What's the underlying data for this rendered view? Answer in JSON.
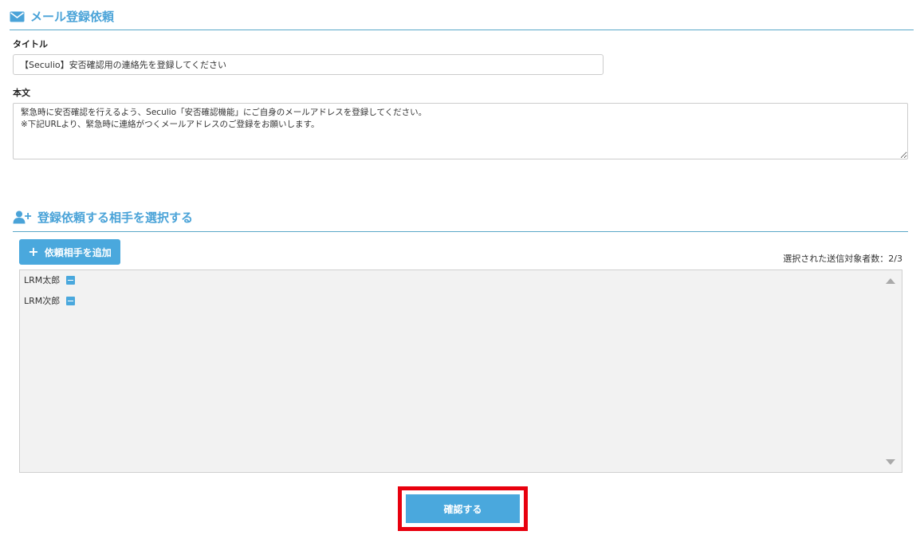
{
  "mail_section": {
    "title": "メール登録依頼",
    "icon": "envelope-icon"
  },
  "form": {
    "title_label": "タイトル",
    "title_value": "【Seculio】安否確認用の連絡先を登録してください",
    "body_label": "本文",
    "body_value": "緊急時に安否確認を行えるよう、Seculio「安否確認機能」にご自身のメールアドレスを登録してください。\n※下記URLより、緊急時に連絡がつくメールアドレスのご登録をお願いします。"
  },
  "recipient_section": {
    "title": "登録依頼する相手を選択する",
    "icon": "user-plus-icon",
    "add_button_label": "依頼相手を追加",
    "count_label": "選択された送信対象者数：",
    "count_value": "2/3",
    "recipients": [
      {
        "name": "LRM太郎"
      },
      {
        "name": "LRM次郎"
      }
    ]
  },
  "footer": {
    "confirm_label": "確認する"
  },
  "colors": {
    "accent": "#4aa8dd",
    "highlight": "#e8000e",
    "list_bg": "#f2f2f2"
  }
}
